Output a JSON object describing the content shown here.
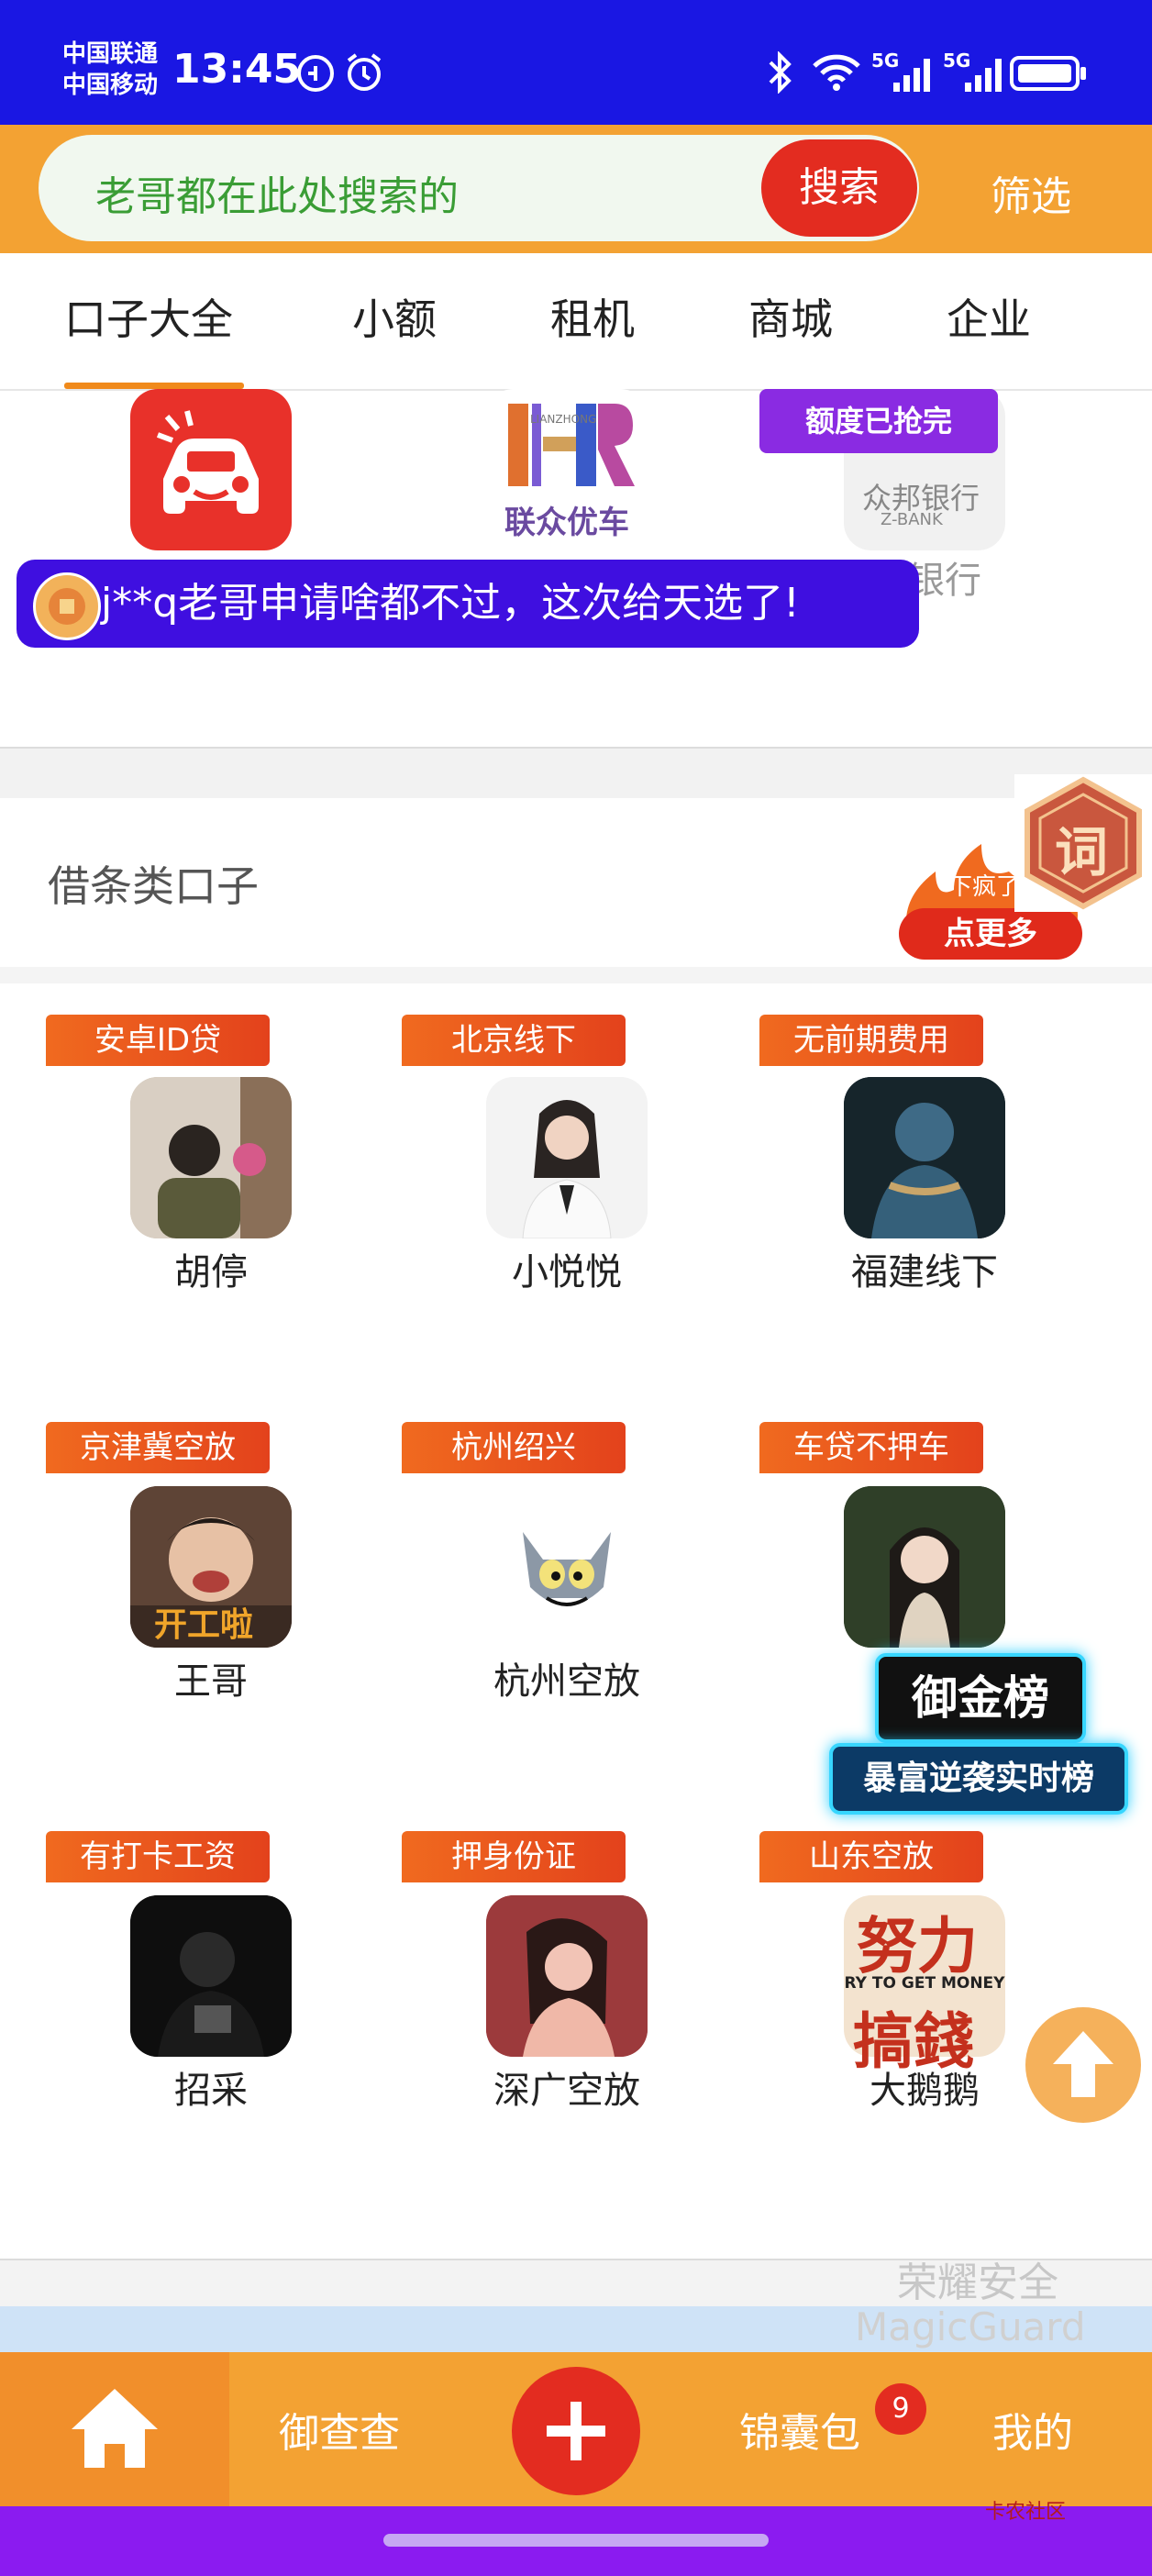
{
  "status_bar": {
    "carrier1": "中国联通",
    "carrier2": "中国移动",
    "time": "13:45",
    "network1": "5G",
    "network2": "5G"
  },
  "search": {
    "placeholder": "老哥都在此处搜索的",
    "button": "搜索",
    "filter": "筛选"
  },
  "tabs": [
    {
      "label": "口子大全",
      "active": true
    },
    {
      "label": "小额"
    },
    {
      "label": "租机"
    },
    {
      "label": "商城"
    },
    {
      "label": "企业"
    }
  ],
  "top_apps": {
    "lz_logo_text": "联众优车",
    "lz_logo_sub": "LIANZHONG",
    "zbank_logo": "众邦银行",
    "zbank_sub": "Z-BANK",
    "zbank_label": "邦银行",
    "quota_badge": "额度已抢完"
  },
  "ticker": {
    "text": "j**q老哥申请啥都不过，这次给天选了!"
  },
  "loan_section": {
    "title": "借条类口子",
    "more_small": "下疯了",
    "more": "点更多",
    "hex_badge": "词"
  },
  "grid": [
    {
      "tag": "安卓ID贷",
      "name": "胡停"
    },
    {
      "tag": "北京线下",
      "name": "小悦悦"
    },
    {
      "tag": "无前期费用",
      "name": "福建线下"
    },
    {
      "tag": "京津冀空放",
      "name": "王哥",
      "image_text": "开工啦"
    },
    {
      "tag": "杭州绍兴",
      "name": "杭州空放"
    },
    {
      "tag": "车贷不押车",
      "name": ""
    },
    {
      "tag": "有打卡工资",
      "name": "招采"
    },
    {
      "tag": "押身份证",
      "name": "深广空放"
    },
    {
      "tag": "山东空放",
      "name": "大鹅鹅",
      "image_text1": "努力",
      "image_text2": "RY TO GET MONEY",
      "image_text3": "搞錢"
    }
  ],
  "floating": {
    "rank_title": "御金榜",
    "rank_sub": "暴富逆袭实时榜"
  },
  "watermark": {
    "line1": "荣耀安全",
    "line2": "MagicGuard",
    "corner": "卡农社区"
  },
  "bottom_nav": {
    "item2": "御查查",
    "item4": "锦囊包",
    "item4_badge": "9",
    "item5": "我的"
  },
  "colors": {
    "status_bg": "#1a17e3",
    "brand_orange": "#f3a233",
    "primary_red": "#e32c20",
    "system_purple": "#8b1bf0"
  }
}
